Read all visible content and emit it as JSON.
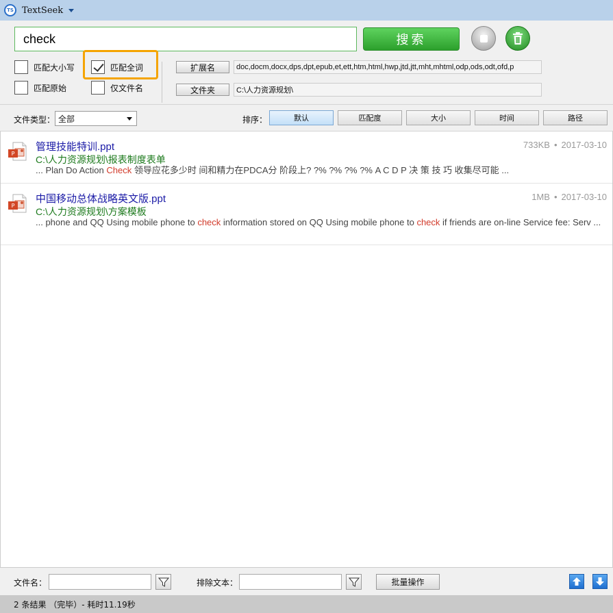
{
  "app": {
    "title": "TextSeek",
    "logo_text": "TS"
  },
  "search": {
    "query": "check",
    "button_label": "搜索"
  },
  "options": {
    "match_case": {
      "label": "匹配大小写",
      "checked": false
    },
    "match_whole_word": {
      "label": "匹配全词",
      "checked": true
    },
    "match_original": {
      "label": "匹配原始",
      "checked": false
    },
    "filename_only": {
      "label": "仅文件名",
      "checked": false
    }
  },
  "extensions": {
    "button_label": "扩展名",
    "value": "doc,docm,docx,dps,dpt,epub,et,ett,htm,html,hwp,jtd,jtt,mht,mhtml,odp,ods,odt,ofd,p"
  },
  "folder": {
    "button_label": "文件夹",
    "value": "C:\\人力资源规划\\"
  },
  "filter": {
    "file_type_label": "文件类型：",
    "file_type_value": "全部",
    "sort_label": "排序：",
    "sort_buttons": [
      "默认",
      "匹配度",
      "大小",
      "时间",
      "路径"
    ],
    "active_sort": "默认"
  },
  "results": [
    {
      "title": "管理技能特训.ppt",
      "path": "C:\\人力资源规划\\报表制度表单",
      "size": "733KB",
      "date": "2017-03-10",
      "snippet_pre": "... Plan Do Action ",
      "snippet_hit": "Check",
      "snippet_post": " 领导应花多少时 间和精力在PDCA分 阶段上? ?% ?% ?% ?% A C D P 决 策 技 巧 收集尽可能 ..."
    },
    {
      "title": "中国移动总体战略英文版.ppt",
      "path": "C:\\人力资源规划\\方案模板",
      "size": "1MB",
      "date": "2017-03-10",
      "snippet_pre": "... phone and QQ Using mobile phone to ",
      "snippet_hit": "check",
      "snippet_mid": " information stored on QQ Using mobile phone to ",
      "snippet_hit2": "check",
      "snippet_post": " if friends are on-line Service fee: Serv ..."
    }
  ],
  "bottom": {
    "filename_label": "文件名：",
    "filename_value": "",
    "exclude_label": "排除文本：",
    "exclude_value": "",
    "batch_label": "批量操作"
  },
  "status": {
    "text": "2 条结果 （完毕）- 耗时11.19秒"
  },
  "colors": {
    "accent_green": "#2ca02c",
    "highlight_orange": "#f5a400",
    "hit_red": "#d23a2a",
    "title_blue": "#1a1aa6",
    "path_green": "#1d7a1d"
  }
}
